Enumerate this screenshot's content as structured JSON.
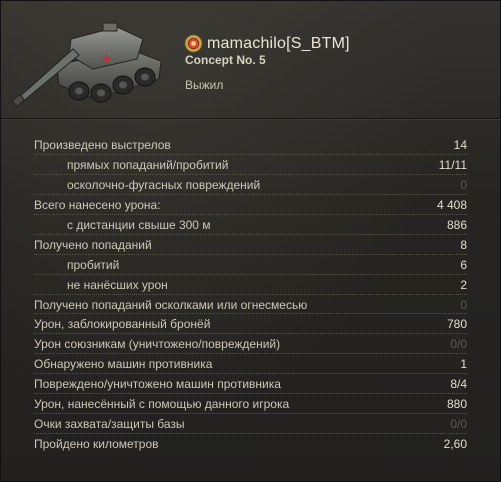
{
  "header": {
    "player_name": "mamachilo[S_BTM]",
    "tank_name": "Concept No. 5",
    "status": "Выжил",
    "tank_icon": "tank-icon",
    "badge_icon": "clan-badge-icon"
  },
  "stats": [
    {
      "label": "Произведено выстрелов",
      "value": "14",
      "sub": false,
      "dim": false
    },
    {
      "label": "прямых попаданий/пробитий",
      "value": "11/11",
      "sub": true,
      "dim": false
    },
    {
      "label": "осколочно-фугасных повреждений",
      "value": "0",
      "sub": true,
      "dim": true
    },
    {
      "label": "Всего нанесено урона:",
      "value": "4 408",
      "sub": false,
      "dim": false
    },
    {
      "label": "с дистанции свыше 300 м",
      "value": "886",
      "sub": true,
      "dim": false
    },
    {
      "label": "Получено попаданий",
      "value": "8",
      "sub": false,
      "dim": false
    },
    {
      "label": "пробитий",
      "value": "6",
      "sub": true,
      "dim": false
    },
    {
      "label": "не нанёсших урон",
      "value": "2",
      "sub": true,
      "dim": false
    },
    {
      "label": "Получено попаданий осколками или огнесмесью",
      "value": "0",
      "sub": false,
      "dim": true
    },
    {
      "label": "Урон, заблокированный бронёй",
      "value": "780",
      "sub": false,
      "dim": false
    },
    {
      "label": "Урон союзникам (уничтожено/повреждений)",
      "value": "0/0",
      "sub": false,
      "dim": true
    },
    {
      "label": "Обнаружено машин противника",
      "value": "1",
      "sub": false,
      "dim": false
    },
    {
      "label": "Повреждено/уничтожено машин противника",
      "value": "8/4",
      "sub": false,
      "dim": false
    },
    {
      "label": "Урон, нанесённый с помощью данного игрока",
      "value": "880",
      "sub": false,
      "dim": false
    },
    {
      "label": "Очки захвата/защиты базы",
      "value": "0/0",
      "sub": false,
      "dim": true
    },
    {
      "label": "Пройдено километров",
      "value": "2,60",
      "sub": false,
      "dim": false
    }
  ]
}
